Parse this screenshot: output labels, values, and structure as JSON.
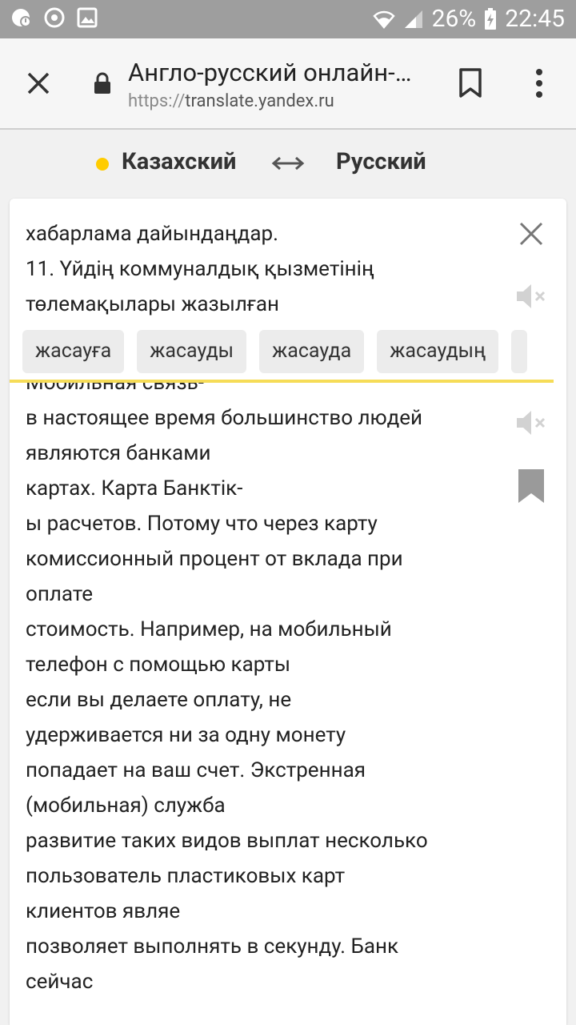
{
  "status_bar": {
    "battery": "26%",
    "time": "22:45"
  },
  "browser": {
    "title": "Англо-русский онлайн-…",
    "url_scheme": "https://",
    "url_host": "translate.yandex.ru"
  },
  "languages": {
    "source": "Казахский",
    "target": "Русский"
  },
  "source": {
    "lines": [
      "хабарлама дайындаңдар.",
      "11. Үйдің коммуналдық қызметінің",
      "төлемақылары жазылған"
    ]
  },
  "suggestions": [
    "жасауға",
    "жасауды",
    "жасауда",
    "жасаудың"
  ],
  "result": {
    "lines": [
      "Мобильная связь-",
      "в настоящее время большинство людей",
      "являются банками",
      "картах. Карта Банктік-",
      "ы расчетов. Потому что через карту",
      "комиссионный процент от вклада при",
      "оплате",
      "стоимость. Например, на мобильный",
      "телефон с помощью карты",
      "если вы делаете оплату, не",
      "удерживается ни за одну монету",
      "попадает на ваш счет. Экстренная",
      "(мобильная) служба",
      "развитие таких видов выплат несколько",
      "пользователь пластиковых карт",
      "клиентов являе",
      "позволяет выполнять в секунду. Банк",
      "сейчас"
    ]
  },
  "colors": {
    "accent": "#ffcc00",
    "divider": "#f6dc57",
    "status_bar": "#9e9e9e"
  }
}
